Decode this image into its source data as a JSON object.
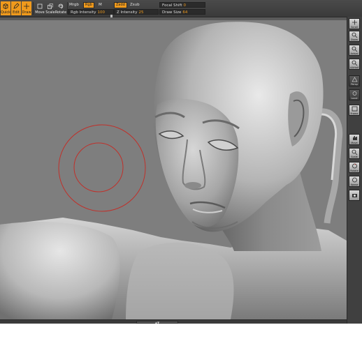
{
  "toolbar": {
    "tools": [
      {
        "name": "quick",
        "label": "Quick",
        "active": true,
        "icon": "cube-icon"
      },
      {
        "name": "edit",
        "label": "Edit",
        "active": true,
        "icon": "pencil-icon"
      },
      {
        "name": "draw",
        "label": "Draw",
        "active": true,
        "icon": "brush-icon"
      },
      {
        "name": "move",
        "label": "Move",
        "active": false,
        "icon": "move-icon"
      },
      {
        "name": "scale",
        "label": "Scale",
        "active": false,
        "icon": "scale-icon"
      },
      {
        "name": "rotate",
        "label": "Rotate",
        "active": false,
        "icon": "rotate-icon"
      }
    ],
    "mrgb_label": "Mrgb",
    "rgb_label": "Rgb",
    "m_label": "M",
    "zadd_label": "Zadd",
    "zsub_label": "Zsub",
    "rgb_intensity_label": "Rgb Intensity",
    "rgb_intensity_value": "100",
    "z_intensity_label": "Z Intensity",
    "z_intensity_value": "25",
    "focal_shift_label": "Focal Shift",
    "focal_shift_value": "0",
    "draw_size_label": "Draw Size",
    "draw_size_value": "64"
  },
  "right_shelf": [
    {
      "label": "Scroll",
      "icon": "scroll-icon"
    },
    {
      "label": "Zoom",
      "icon": "zoom-icon"
    },
    {
      "label": "Actual",
      "icon": "actual-size-icon"
    },
    {
      "label": "AAHalf",
      "icon": "half-size-icon"
    },
    {
      "label": "Persp",
      "icon": "perspective-icon"
    },
    {
      "label": "Local",
      "icon": "local-icon"
    },
    {
      "label": "Frame",
      "icon": "frame-icon"
    },
    {
      "label": "Move",
      "icon": "hand-move-icon"
    },
    {
      "label": "Scale",
      "icon": "scale-view-icon"
    },
    {
      "label": "Rotate",
      "icon": "rotate-view-icon"
    },
    {
      "label": "Xpose",
      "icon": "xpose-icon"
    },
    {
      "label": "",
      "icon": "camera-icon"
    }
  ],
  "canvas": {
    "brush_color": "#c0302a",
    "background": "#7e7e7e"
  },
  "bottom": {
    "handle_glyph": "▲▼"
  }
}
